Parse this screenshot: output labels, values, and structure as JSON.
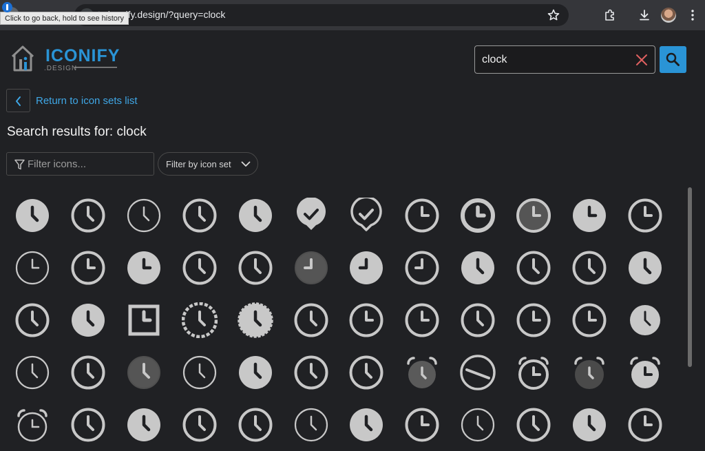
{
  "browser": {
    "url": "ts.iconify.design/?query=clock",
    "tooltip": "Click to go back, hold to see history"
  },
  "header": {
    "logo_text": "ICONIFY",
    "logo_subtext": ".DESIGN"
  },
  "search": {
    "value": "clock",
    "clear_icon": "x-icon",
    "button_icon": "search-icon"
  },
  "nav": {
    "back_label": "Return to icon sets list"
  },
  "results": {
    "title": "Search results for: clock"
  },
  "filters": {
    "filter_placeholder": "Filter icons...",
    "icon_set_label": "Filter by icon set"
  },
  "colors": {
    "accent": "#2a94d6",
    "link": "#3fa7e6",
    "icon": "#c8c8c8",
    "background": "#202124",
    "clear": "#e06060"
  },
  "icons": [
    "clock-filled",
    "clock-outline",
    "clock-thin",
    "clock-outline",
    "clock-filled",
    "badge-check-filled",
    "badge-check-outline",
    "clock-l-outline",
    "clock-l-bold",
    "clock-l-duotone",
    "clock-l-filled",
    "clock-l-outline",
    "clock-l-thin",
    "clock-l-outline",
    "clock-l-filled",
    "clock-outline",
    "clock-outline",
    "clock-j-duotone",
    "clock-j-filled",
    "clock-j-outline",
    "clock-filled",
    "clock-outline",
    "clock-outline",
    "clock-filled",
    "clock-outline",
    "clock-filled",
    "clock-square",
    "clock-dashed",
    "clock-jagged-filled",
    "clock-outline",
    "clock-l-outline",
    "clock-l-outline",
    "clock-outline",
    "clock-l-outline",
    "clock-l-outline",
    "clock-filled-small",
    "clock-thin",
    "clock-outline",
    "clock-duotone",
    "clock-thin",
    "clock-filled",
    "clock-outline",
    "clock-outline",
    "alarm-duotone",
    "clock-slash",
    "alarm-l-outline",
    "alarm-l-duotone",
    "alarm-l-filled",
    "alarm-l-thin",
    "clock-outline",
    "clock-filled",
    "clock-outline",
    "clock-outline",
    "clock-thin",
    "clock-filled",
    "clock-l-outline",
    "clock-thin",
    "clock-outline",
    "clock-filled",
    "clock-l-outline"
  ]
}
